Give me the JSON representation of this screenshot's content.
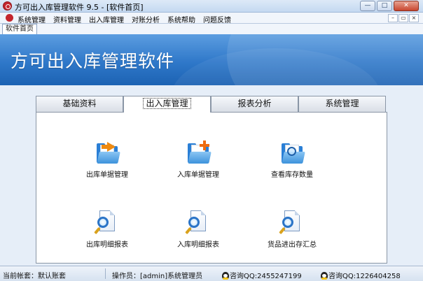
{
  "window": {
    "title": "方可出入库管理软件 9.5 - [软件首页]",
    "controls": {
      "minimize": "—",
      "maximize": "□",
      "close": "✕"
    }
  },
  "menu": {
    "items": [
      "系统管理",
      "资料管理",
      "出入库管理",
      "对账分析",
      "系统帮助",
      "问题反馈"
    ],
    "mdi_controls": {
      "minimize": "–",
      "restore": "▭",
      "close": "×"
    }
  },
  "doc_tab": {
    "label": "软件首页"
  },
  "banner": {
    "title": "方可出入库管理软件"
  },
  "tabs": [
    {
      "label": "基础资料",
      "active": false
    },
    {
      "label": "出入库管理",
      "active": true
    },
    {
      "label": "报表分析",
      "active": false
    },
    {
      "label": "系统管理",
      "active": false
    }
  ],
  "functions": [
    {
      "label": "出库单据管理",
      "icon": "folder-export-icon"
    },
    {
      "label": "入库单据管理",
      "icon": "folder-add-icon"
    },
    {
      "label": "查看库存数量",
      "icon": "folder-search-icon"
    },
    {
      "label": "出库明细报表",
      "icon": "report-search-icon"
    },
    {
      "label": "入库明细报表",
      "icon": "report-search-icon"
    },
    {
      "label": "货品进出存汇总",
      "icon": "report-search-icon"
    }
  ],
  "status": {
    "account": "当前帐套：默认账套",
    "operator": "操作员：[admin]系统管理员",
    "qq1": "咨询QQ:2455247199",
    "qq2": "咨询QQ:1226404258"
  }
}
